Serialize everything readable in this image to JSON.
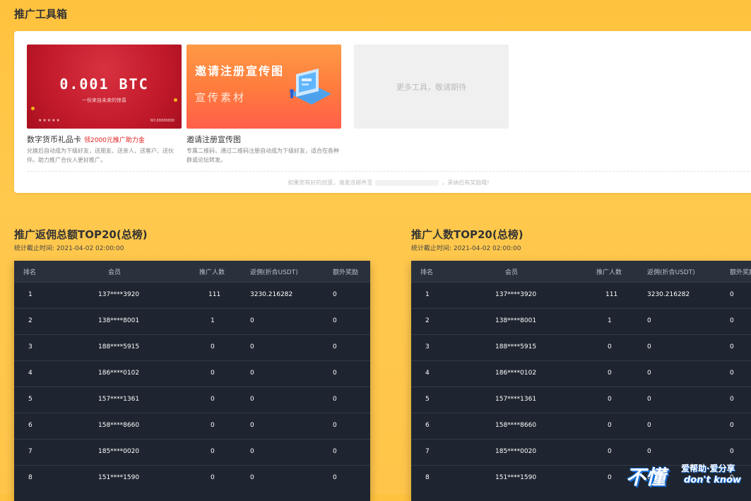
{
  "toolbox": {
    "title": "推广工具箱",
    "cards": [
      {
        "amount": "0.001 BTC",
        "image_subtitle": "一份来自未来的惊喜",
        "image_stars": "★★★★★",
        "image_no": "NO.88888888",
        "title": "数字货币礼品卡",
        "tag": "领2000元推广助力金",
        "desc": "兑换后自动成为下级好友，送朋友、送亲人、送客户、送伙伴。助力推广合伙人更好推广。"
      },
      {
        "image_title": "邀请注册宣传图",
        "image_subtitle": "宣传素材",
        "title": "邀请注册宣传图",
        "desc": "专属二维码，通过二维码注册自动成为下级好友，适合在各种群或论坛转发。"
      },
      {
        "placeholder": "更多工具，敬请期待"
      }
    ],
    "footnote_prefix": "如果您有好的创意，请发送邮件至",
    "footnote_suffix": "，采纳后有奖励哦!"
  },
  "commission_board": {
    "title": "推广返佣总额TOP20(总榜)",
    "stats_time": "统计截止时间: 2021-04-02 02:00:00"
  },
  "referral_board": {
    "title": "推广人数TOP20(总榜)",
    "stats_time": "统计截止时间: 2021-04-02 02:00:00"
  },
  "table": {
    "headers": [
      "排名",
      "会员",
      "推广人数",
      "返佣(折合USDT)",
      "额外奖励"
    ],
    "rows": [
      [
        "1",
        "137****3920",
        "111",
        "3230.216282",
        "0"
      ],
      [
        "2",
        "138****8001",
        "1",
        "0",
        "0"
      ],
      [
        "3",
        "188****5915",
        "0",
        "0",
        "0"
      ],
      [
        "4",
        "186****0102",
        "0",
        "0",
        "0"
      ],
      [
        "5",
        "157****1361",
        "0",
        "0",
        "0"
      ],
      [
        "6",
        "158****8660",
        "0",
        "0",
        "0"
      ],
      [
        "7",
        "185****0020",
        "0",
        "0",
        "0"
      ],
      [
        "8",
        "151****1590",
        "0",
        "0",
        "0"
      ]
    ]
  },
  "watermark": {
    "big": "不懂",
    "line1": "爱帮助·爱分享",
    "line2": "don't know"
  },
  "colors": {
    "background": "#ffc23e",
    "table_bg": "#1e2530",
    "table_header_bg": "#29313d",
    "tag_red": "#e02020",
    "btc_red": "#c21a2b",
    "invite_orange": "#ff7a3e"
  }
}
